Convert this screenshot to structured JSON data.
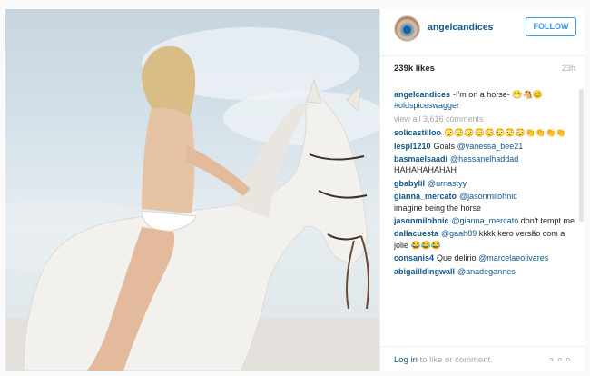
{
  "post": {
    "username": "angelcandices",
    "follow_label": "FOLLOW",
    "likes": "239k likes",
    "time": "23h"
  },
  "caption": {
    "user": "angelcandices",
    "text": "-I'm on a horse- 😁🐴😊",
    "hashtag": "#oldspiceswagger",
    "view_all": "view all 3,616 comments"
  },
  "comments": [
    {
      "user": "solicastilloo",
      "text": "😳😳😳😳😳😳😳😳👏👏👏👏",
      "mention": ""
    },
    {
      "user": "lespl1210",
      "text": "Goals",
      "mention": "@vanessa_bee21"
    },
    {
      "user": "basmaelsaadi",
      "text": "HAHAHAHAHAH",
      "mention": "@hassanelhaddad"
    },
    {
      "user": "gbabylil",
      "text": "",
      "mention": "@urnastyy"
    },
    {
      "user": "gianna_mercato",
      "text": "imagine being the horse",
      "mention": "@jasonmilohnic"
    },
    {
      "user": "jasonmilohnic",
      "text": "don't tempt me",
      "mention": "@gianna_mercato"
    },
    {
      "user": "dallacuesta",
      "text": "kkkk kero versão com a jolie 😂😂😂",
      "mention": "@gaah89"
    },
    {
      "user": "consanis4",
      "text": "Que delirio",
      "mention": "@marcelaeolivares"
    },
    {
      "user": "abigailldingwall",
      "text": "",
      "mention": "@anadegannes"
    }
  ],
  "footer": {
    "login_link": "Log in",
    "login_text": " to like or comment.",
    "more": "∘∘∘"
  },
  "colors": {
    "link": "#125688",
    "follow": "#3897f0",
    "muted": "#a5a7aa"
  },
  "icons": {
    "avatar": "profile-avatar-icon",
    "more": "more-options-icon"
  }
}
